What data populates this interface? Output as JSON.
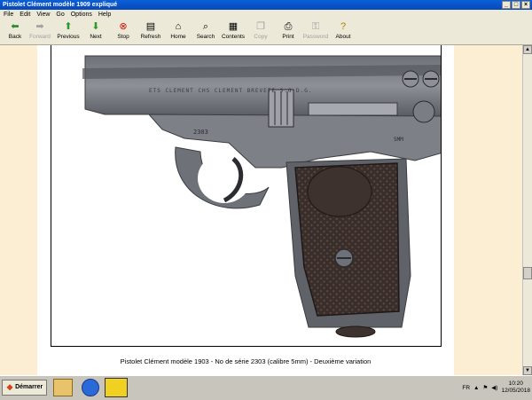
{
  "window": {
    "title": "Pistolet Clément modèle 1909 expliqué"
  },
  "menu": [
    "File",
    "Edit",
    "View",
    "Go",
    "Options",
    "Help"
  ],
  "toolbar": [
    {
      "label": "Back",
      "icon": "back-arrow-icon",
      "enabled": true
    },
    {
      "label": "Forward",
      "icon": "forward-arrow-icon",
      "enabled": false
    },
    {
      "label": "Previous",
      "icon": "up-arrow-icon",
      "enabled": true
    },
    {
      "label": "Next",
      "icon": "down-arrow-icon",
      "enabled": true
    },
    {
      "label": "Stop",
      "icon": "stop-icon",
      "enabled": true
    },
    {
      "label": "Refresh",
      "icon": "refresh-icon",
      "enabled": true
    },
    {
      "label": "Home",
      "icon": "home-icon",
      "enabled": true
    },
    {
      "label": "Search",
      "icon": "search-icon",
      "enabled": true
    },
    {
      "label": "Contents",
      "icon": "contents-icon",
      "enabled": true
    },
    {
      "label": "Copy",
      "icon": "copy-icon",
      "enabled": false
    },
    {
      "label": "Print",
      "icon": "print-icon",
      "enabled": true
    },
    {
      "label": "Password",
      "icon": "password-icon",
      "enabled": false
    },
    {
      "label": "About",
      "icon": "about-icon",
      "enabled": true
    }
  ],
  "content": {
    "caption": "Pistolet Clément modèle 1903 - No de série 2303 (calibre 5mm) - Deuxième variation",
    "image": "pistol-photo",
    "slide_marking": "ETS CLEMENT CHS CLEMENT BREVETE S.G.D.G.",
    "serial": "2303",
    "caliber": "5MM"
  },
  "taskbar": {
    "start_label": "Démarrer",
    "lang": "FR",
    "time": "10:20",
    "date": "12/05/2018"
  },
  "colors": {
    "page_bg": "#fbeed2",
    "title_bg": "#0a5fd8",
    "chrome": "#ece9d8"
  }
}
